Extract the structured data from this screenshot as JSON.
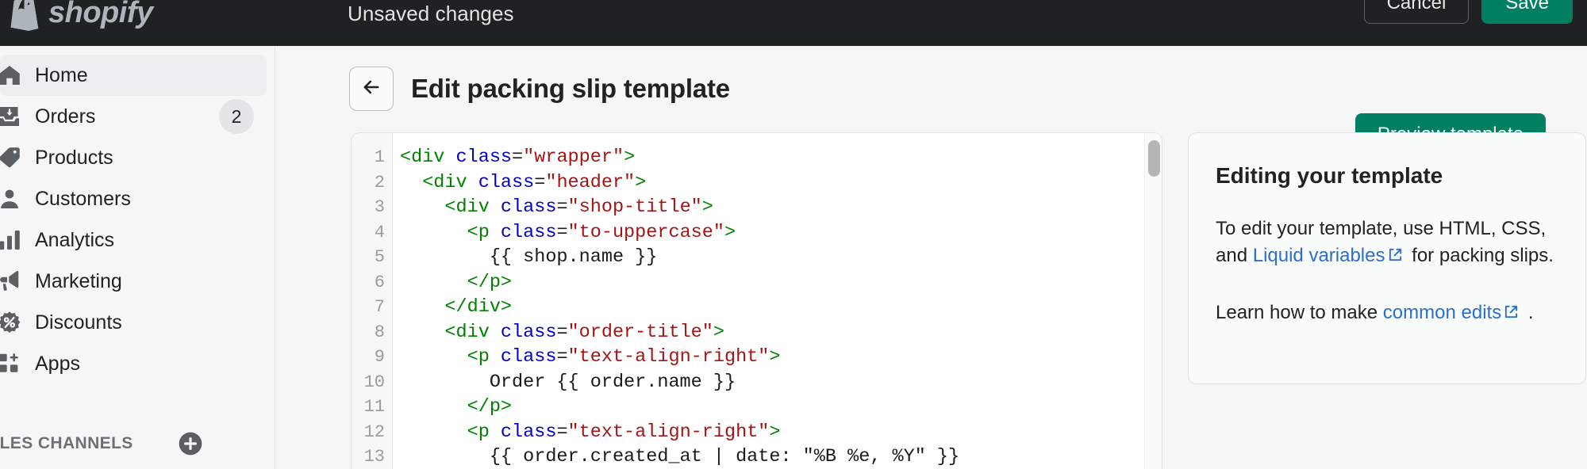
{
  "topbar": {
    "logo_text": "shopify",
    "status_text": "Unsaved changes",
    "cancel_label": "Cancel",
    "save_label": "Save",
    "save_color": "#008060",
    "background": "#1f2223"
  },
  "sidebar": {
    "items": [
      {
        "label": "Home",
        "icon": "home-icon",
        "active": true,
        "badge": ""
      },
      {
        "label": "Orders",
        "icon": "orders-icon",
        "active": false,
        "badge": "2"
      },
      {
        "label": "Products",
        "icon": "products-icon",
        "active": false,
        "badge": ""
      },
      {
        "label": "Customers",
        "icon": "customers-icon",
        "active": false,
        "badge": ""
      },
      {
        "label": "Analytics",
        "icon": "analytics-icon",
        "active": false,
        "badge": ""
      },
      {
        "label": "Marketing",
        "icon": "marketing-icon",
        "active": false,
        "badge": ""
      },
      {
        "label": "Discounts",
        "icon": "discounts-icon",
        "active": false,
        "badge": ""
      },
      {
        "label": "Apps",
        "icon": "apps-icon",
        "active": false,
        "badge": ""
      }
    ],
    "section_label": "ALES CHANNELS",
    "add_icon": "plus-circle-icon"
  },
  "page": {
    "back_icon": "arrow-left-icon",
    "title": "Edit packing slip template",
    "preview_label": "Preview template"
  },
  "editor": {
    "line_numbers": [
      "1",
      "2",
      "3",
      "4",
      "5",
      "6",
      "7",
      "8",
      "9",
      "10",
      "11",
      "12",
      "13"
    ],
    "lines": [
      [
        {
          "t": "<div ",
          "c": "tg"
        },
        {
          "t": "class",
          "c": "at"
        },
        {
          "t": "=",
          "c": "tx"
        },
        {
          "t": "\"wrapper\"",
          "c": "st"
        },
        {
          "t": ">",
          "c": "tg"
        }
      ],
      [
        {
          "t": "  <div ",
          "c": "tg"
        },
        {
          "t": "class",
          "c": "at"
        },
        {
          "t": "=",
          "c": "tx"
        },
        {
          "t": "\"header\"",
          "c": "st"
        },
        {
          "t": ">",
          "c": "tg"
        }
      ],
      [
        {
          "t": "    <div ",
          "c": "tg"
        },
        {
          "t": "class",
          "c": "at"
        },
        {
          "t": "=",
          "c": "tx"
        },
        {
          "t": "\"shop-title\"",
          "c": "st"
        },
        {
          "t": ">",
          "c": "tg"
        }
      ],
      [
        {
          "t": "      <p ",
          "c": "tg"
        },
        {
          "t": "class",
          "c": "at"
        },
        {
          "t": "=",
          "c": "tx"
        },
        {
          "t": "\"to-uppercase\"",
          "c": "st"
        },
        {
          "t": ">",
          "c": "tg"
        }
      ],
      [
        {
          "t": "        {{ shop.name }}",
          "c": "tx"
        }
      ],
      [
        {
          "t": "      </p>",
          "c": "tg"
        }
      ],
      [
        {
          "t": "    </div>",
          "c": "tg"
        }
      ],
      [
        {
          "t": "    <div ",
          "c": "tg"
        },
        {
          "t": "class",
          "c": "at"
        },
        {
          "t": "=",
          "c": "tx"
        },
        {
          "t": "\"order-title\"",
          "c": "st"
        },
        {
          "t": ">",
          "c": "tg"
        }
      ],
      [
        {
          "t": "      <p ",
          "c": "tg"
        },
        {
          "t": "class",
          "c": "at"
        },
        {
          "t": "=",
          "c": "tx"
        },
        {
          "t": "\"text-align-right\"",
          "c": "st"
        },
        {
          "t": ">",
          "c": "tg"
        }
      ],
      [
        {
          "t": "        Order {{ order.name }}",
          "c": "tx"
        }
      ],
      [
        {
          "t": "      </p>",
          "c": "tg"
        }
      ],
      [
        {
          "t": "      <p ",
          "c": "tg"
        },
        {
          "t": "class",
          "c": "at"
        },
        {
          "t": "=",
          "c": "tx"
        },
        {
          "t": "\"text-align-right\"",
          "c": "st"
        },
        {
          "t": ">",
          "c": "tg"
        }
      ],
      [
        {
          "t": "        {{ order.created_at | date: \"%B %e, %Y\" }}",
          "c": "tx"
        }
      ]
    ]
  },
  "help": {
    "title": "Editing your template",
    "p1_before": "To edit your template, use HTML, CSS, and ",
    "p1_link": "Liquid variables",
    "p1_after": " for packing slips.",
    "p2_before": "Learn how to make ",
    "p2_link": "common edits",
    "p2_after": " .",
    "link_color": "#2c6ecb"
  }
}
